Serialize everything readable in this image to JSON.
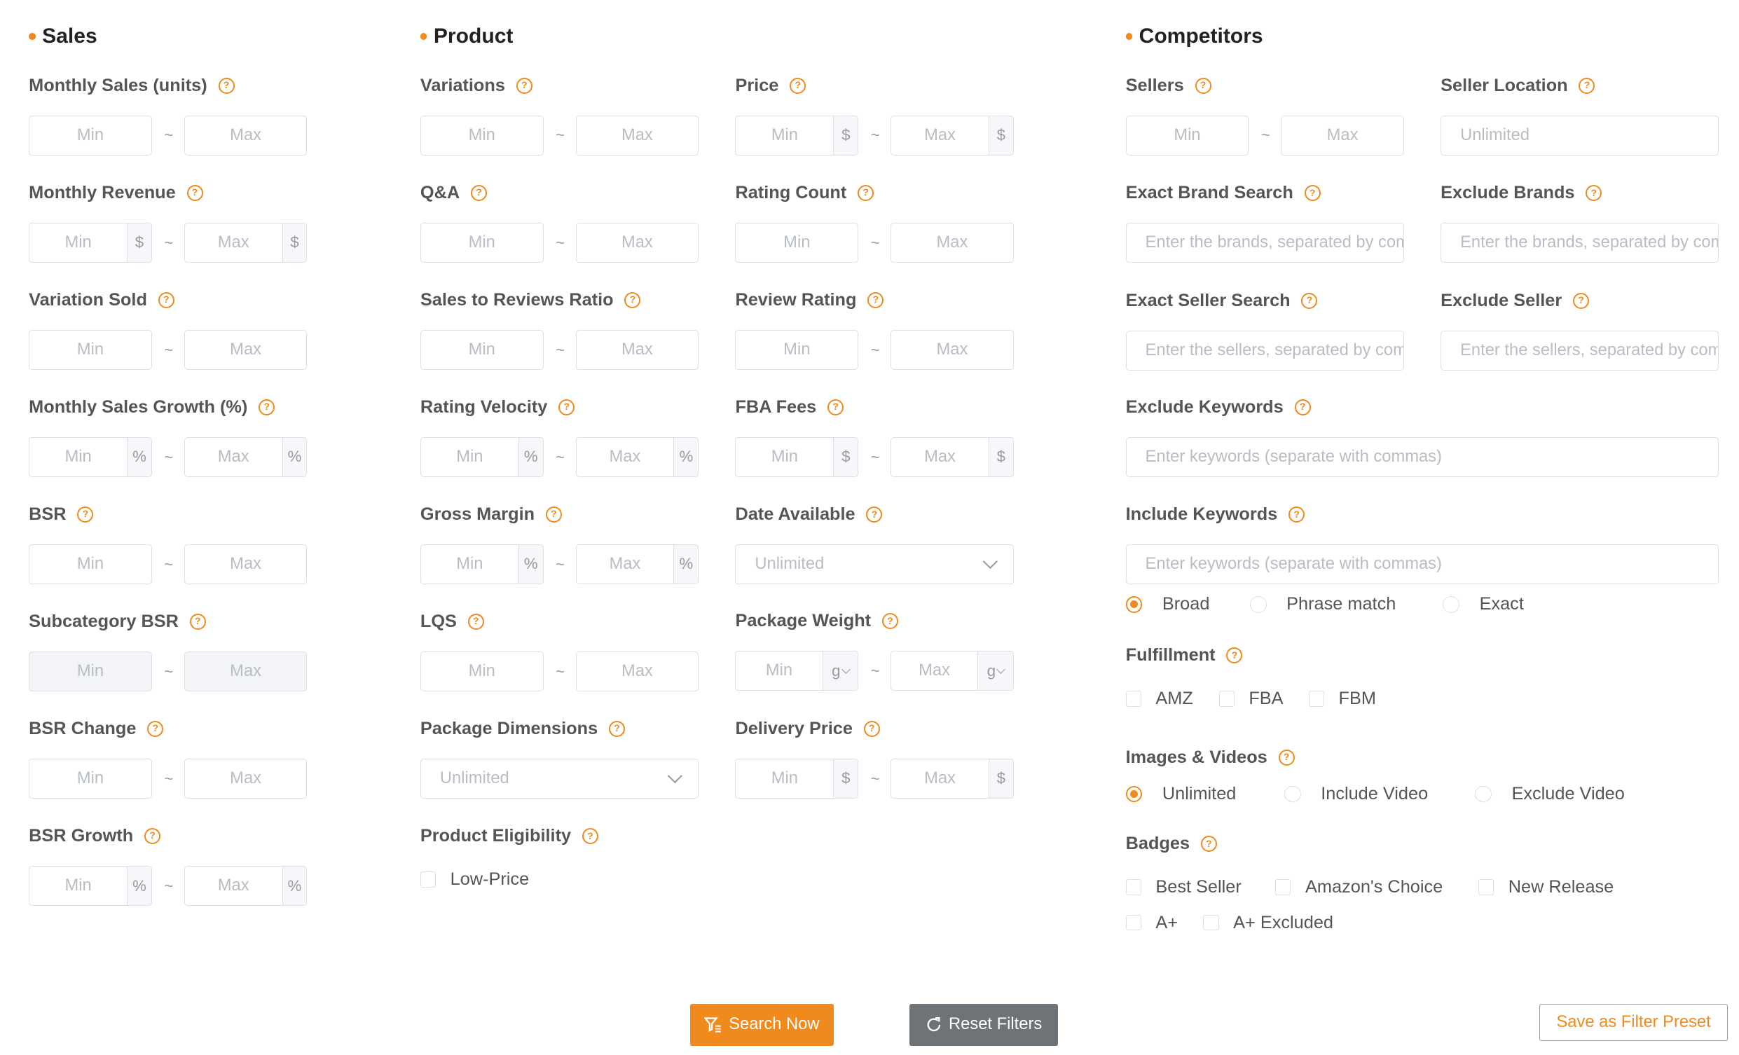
{
  "colors": {
    "accent": "#f08a1c",
    "reset_button": "#6e7378",
    "border": "#dcdfe6"
  },
  "placeholders": {
    "min": "Min",
    "max": "Max",
    "unlimited": "Unlimited",
    "brands": "Enter the brands, separated by commas",
    "sellers": "Enter the sellers, separated by commas",
    "keywords": "Enter keywords (separate with commas)"
  },
  "units": {
    "dollar": "$",
    "percent": "%",
    "gram": "g"
  },
  "sections": {
    "sales": "Sales",
    "product": "Product",
    "competitors": "Competitors"
  },
  "labels": {
    "monthly_sales_units": "Monthly Sales (units)",
    "monthly_revenue": "Monthly Revenue",
    "variation_sold": "Variation Sold",
    "monthly_sales_growth": "Monthly Sales Growth (%)",
    "bsr": "BSR",
    "subcategory_bsr": "Subcategory BSR",
    "bsr_change": "BSR Change",
    "bsr_growth": "BSR Growth",
    "variations": "Variations",
    "qa": "Q&A",
    "sales_to_reviews_ratio": "Sales to Reviews Ratio",
    "rating_velocity": "Rating Velocity",
    "gross_margin": "Gross Margin",
    "lqs": "LQS",
    "package_dimensions": "Package Dimensions",
    "product_eligibility": "Product Eligibility",
    "price": "Price",
    "rating_count": "Rating Count",
    "review_rating": "Review Rating",
    "fba_fees": "FBA Fees",
    "date_available": "Date Available",
    "package_weight": "Package Weight",
    "delivery_price": "Delivery Price",
    "sellers": "Sellers",
    "seller_location": "Seller Location",
    "exact_brand_search": "Exact Brand Search",
    "exclude_brands": "Exclude Brands",
    "exact_seller_search": "Exact Seller Search",
    "exclude_seller": "Exclude Seller",
    "exclude_keywords": "Exclude Keywords",
    "include_keywords": "Include Keywords",
    "fulfillment": "Fulfillment",
    "images_videos": "Images & Videos",
    "badges": "Badges"
  },
  "options": {
    "low_price": "Low-Price",
    "match_broad": "Broad",
    "match_phrase": "Phrase match",
    "match_exact": "Exact",
    "amz": "AMZ",
    "fba": "FBA",
    "fbm": "FBM",
    "video_unlimited": "Unlimited",
    "video_include": "Include Video",
    "video_exclude": "Exclude Video",
    "best_seller": "Best Seller",
    "amazons_choice": "Amazon's Choice",
    "new_release": "New Release",
    "a_plus": "A+",
    "a_plus_excluded": "A+ Excluded"
  },
  "buttons": {
    "search": "Search Now",
    "reset": "Reset Filters",
    "save_preset": "Save as Filter Preset"
  }
}
